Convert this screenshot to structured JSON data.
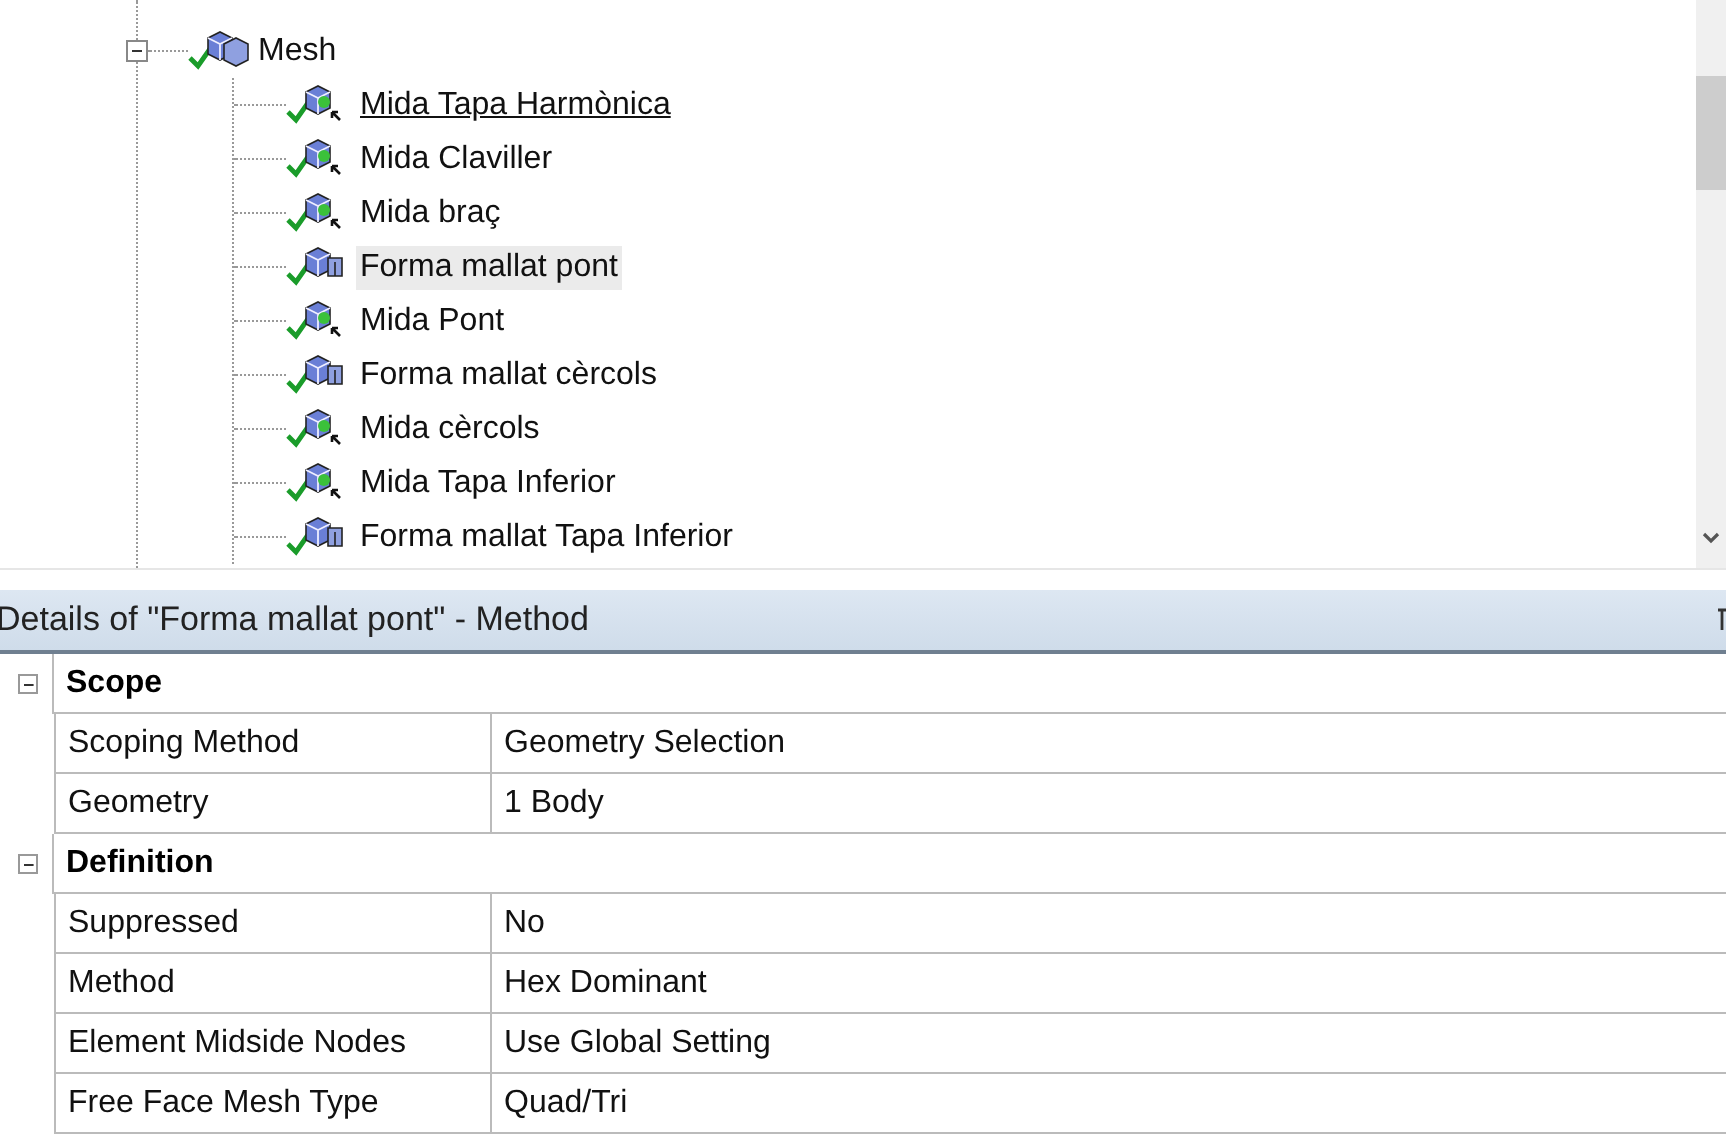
{
  "tree": {
    "label": "Mesh",
    "expanded": true,
    "children": [
      {
        "label": "Mida Tapa Harmònica",
        "kind": "sizing",
        "selected": false,
        "underlined": true
      },
      {
        "label": "Mida Claviller",
        "kind": "sizing",
        "selected": false,
        "underlined": false
      },
      {
        "label": "Mida braç",
        "kind": "sizing",
        "selected": false,
        "underlined": false
      },
      {
        "label": "Forma mallat pont",
        "kind": "method",
        "selected": true,
        "underlined": false
      },
      {
        "label": "Mida Pont",
        "kind": "sizing",
        "selected": false,
        "underlined": false
      },
      {
        "label": "Forma mallat cèrcols",
        "kind": "method",
        "selected": false,
        "underlined": false
      },
      {
        "label": "Mida cèrcols",
        "kind": "sizing",
        "selected": false,
        "underlined": false
      },
      {
        "label": "Mida Tapa Inferior",
        "kind": "sizing",
        "selected": false,
        "underlined": false
      },
      {
        "label": "Forma mallat Tapa Inferior",
        "kind": "method",
        "selected": false,
        "underlined": false
      }
    ]
  },
  "details": {
    "title": "Details of \"Forma mallat pont\" - Method",
    "groups": [
      {
        "name": "Scope",
        "expanded": true,
        "rows": [
          {
            "property": "Scoping Method",
            "value": "Geometry Selection"
          },
          {
            "property": "Geometry",
            "value": "1 Body"
          }
        ]
      },
      {
        "name": "Definition",
        "expanded": true,
        "rows": [
          {
            "property": "Suppressed",
            "value": "No"
          },
          {
            "property": "Method",
            "value": "Hex Dominant"
          },
          {
            "property": "Element Midside Nodes",
            "value": "Use Global Setting"
          },
          {
            "property": "Free Face Mesh Type",
            "value": "Quad/Tri"
          }
        ]
      }
    ]
  }
}
